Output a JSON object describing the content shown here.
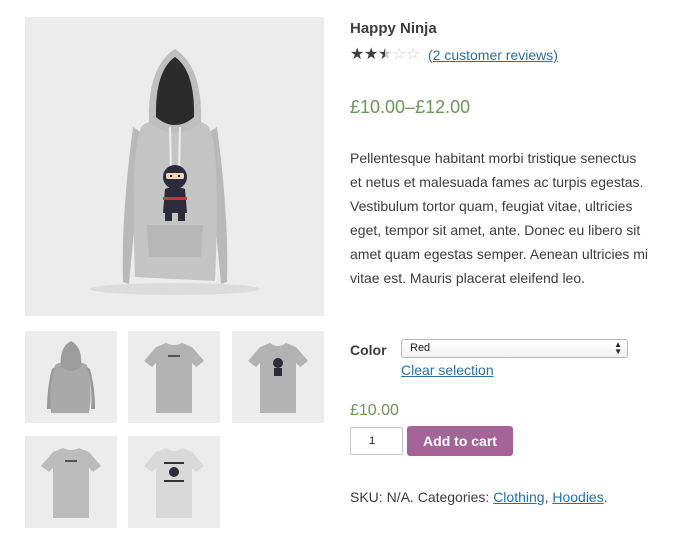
{
  "product": {
    "title": "Happy Ninja",
    "rating": {
      "stars_value": 2.5,
      "stars_max": 5,
      "reviews_link": "(2 customer reviews)"
    },
    "price_range": "£10.00–£12.00",
    "description": "Pellentesque habitant morbi tristique senectus et netus et malesuada fames ac turpis egestas. Vestibulum tortor quam, feugiat vitae, ultricies eget, tempor sit amet, ante. Donec eu libero sit amet quam egestas semper. Aenean ultricies mi vitae est. Mauris placerat eleifend leo.",
    "variation": {
      "label": "Color",
      "selected": "Red",
      "clear_link": "Clear selection",
      "price": "£10.00"
    },
    "quantity": "1",
    "add_to_cart_label": "Add to cart",
    "meta": {
      "sku_label": "SKU:",
      "sku_value": "N/A.",
      "categories_label": "Categories:",
      "categories": [
        "Clothing",
        "Hoodies"
      ],
      "separator": ",",
      "end": "."
    }
  },
  "gallery": {
    "main_image": "hoodie-with-ninja-print",
    "thumbnails": [
      "hoodie-back-view",
      "tshirt-back-view",
      "tshirt-front-ninja",
      "tshirt-back-view",
      "tshirt-front-ninja-logo"
    ]
  },
  "colors": {
    "price_green": "#6d9459",
    "link_blue": "#2c6fa0",
    "button_purple": "#a46497",
    "text": "#3d3d3d",
    "image_bg": "#ececec"
  }
}
